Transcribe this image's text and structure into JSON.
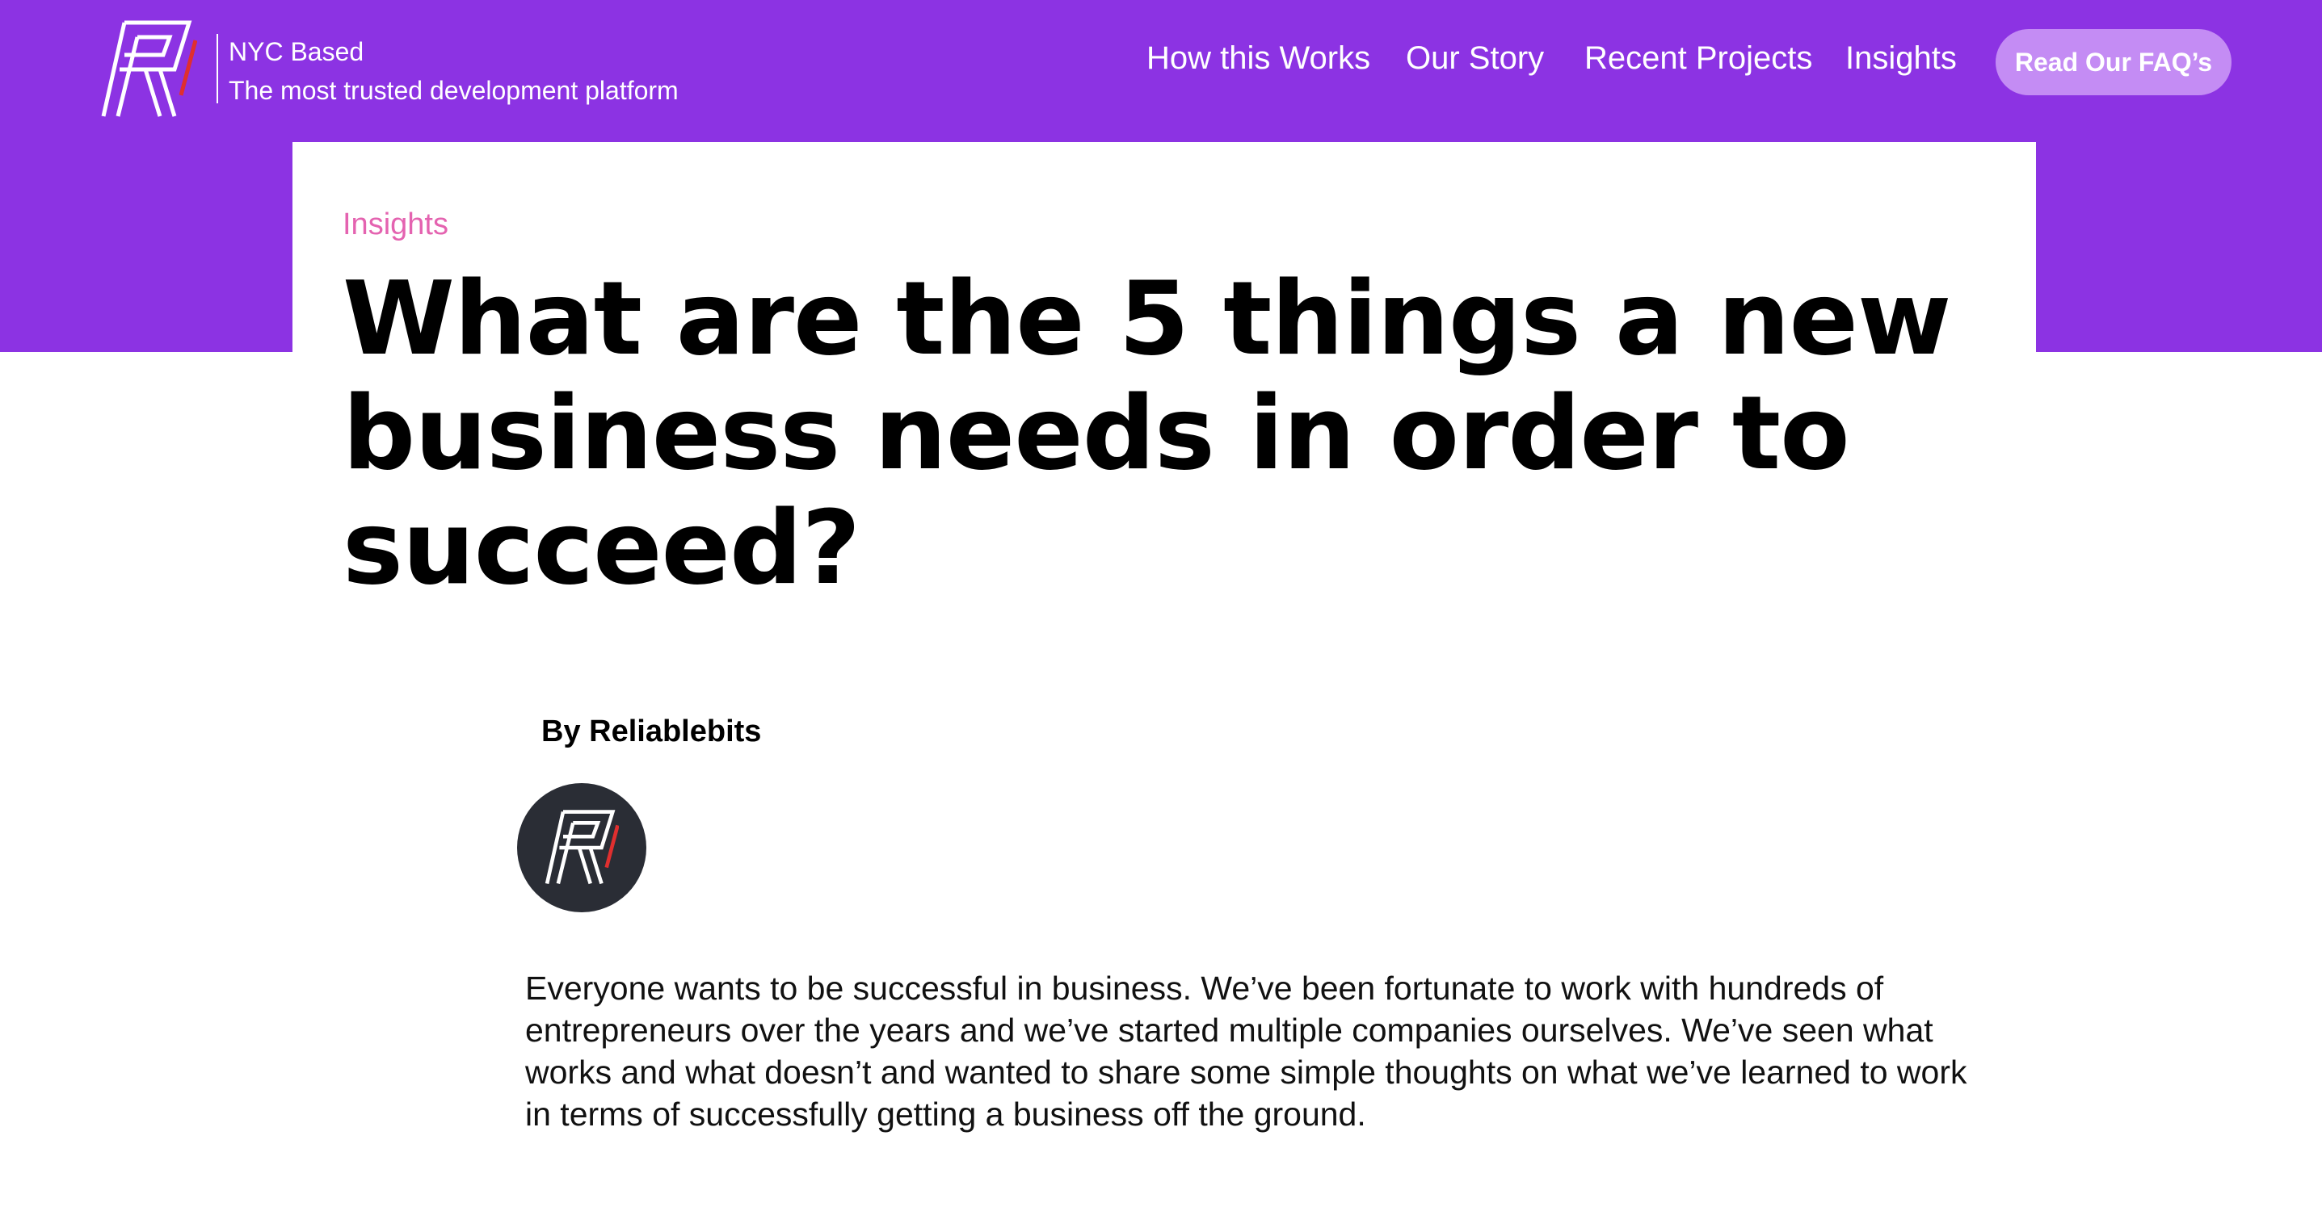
{
  "header": {
    "logo_icon": "reliablebits-r-logo",
    "tagline_city": "NYC Based",
    "tagline_desc": "The most trusted development platform",
    "brand_color": "#8c33e3",
    "accent_color": "#e02f2f"
  },
  "nav": {
    "items": [
      {
        "label": "How this Works"
      },
      {
        "label": "Our Story"
      },
      {
        "label": "Recent Projects"
      },
      {
        "label": "Insights"
      }
    ],
    "cta_label": "Read Our FAQ’s",
    "cta_color": "#c48cf4"
  },
  "article": {
    "category": "Insights",
    "category_color": "#e463b0",
    "title": "What are the 5 things a new business needs in order to succeed?",
    "author": "By Reliablebits",
    "avatar_icon": "reliablebits-r-logo",
    "body": "Everyone wants to be successful in business. We’ve been fortunate to work with hundreds of entrepreneurs over the years and we’ve started multiple companies ourselves. We’ve seen what works and what doesn’t and wanted to share some simple thoughts on what we’ve learned to work in terms of successfully getting a business off the ground."
  }
}
